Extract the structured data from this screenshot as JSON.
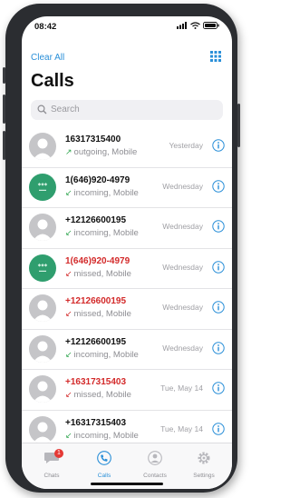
{
  "status": {
    "time": "08:42"
  },
  "header": {
    "clear_all": "Clear All",
    "title": "Calls"
  },
  "search": {
    "placeholder": "Search"
  },
  "calls": [
    {
      "number": "16317315400",
      "type": "outgoing, Mobile",
      "kind": "outgoing",
      "when": "Yesterday",
      "avatar": "gray",
      "missed": false
    },
    {
      "number": "1(646)920-4979",
      "type": "incoming, Mobile",
      "kind": "incoming",
      "when": "Wednesday",
      "avatar": "green",
      "missed": false
    },
    {
      "number": "+12126600195",
      "type": "incoming, Mobile",
      "kind": "incoming",
      "when": "Wednesday",
      "avatar": "gray",
      "missed": false
    },
    {
      "number": "1(646)920-4979",
      "type": "missed, Mobile",
      "kind": "missed",
      "when": "Wednesday",
      "avatar": "green",
      "missed": true
    },
    {
      "number": "+12126600195",
      "type": "missed, Mobile",
      "kind": "missed",
      "when": "Wednesday",
      "avatar": "gray",
      "missed": true
    },
    {
      "number": "+12126600195",
      "type": "incoming, Mobile",
      "kind": "incoming",
      "when": "Wednesday",
      "avatar": "gray",
      "missed": false
    },
    {
      "number": "+16317315403",
      "type": "missed, Mobile",
      "kind": "missed",
      "when": "Tue, May 14",
      "avatar": "gray",
      "missed": true
    },
    {
      "number": "+16317315403",
      "type": "incoming, Mobile",
      "kind": "incoming",
      "when": "Tue, May 14",
      "avatar": "gray",
      "missed": false
    }
  ],
  "tabs": [
    {
      "label": "Chats",
      "icon": "chat-bubble-icon",
      "badge": "1",
      "active": false
    },
    {
      "label": "Calls",
      "icon": "phone-icon",
      "active": true
    },
    {
      "label": "Contacts",
      "icon": "person-icon",
      "active": false
    },
    {
      "label": "Settings",
      "icon": "gear-icon",
      "active": false
    }
  ],
  "colors": {
    "accent": "#2a8fd8",
    "missed": "#d32a2a",
    "incoming": "#34a853"
  }
}
